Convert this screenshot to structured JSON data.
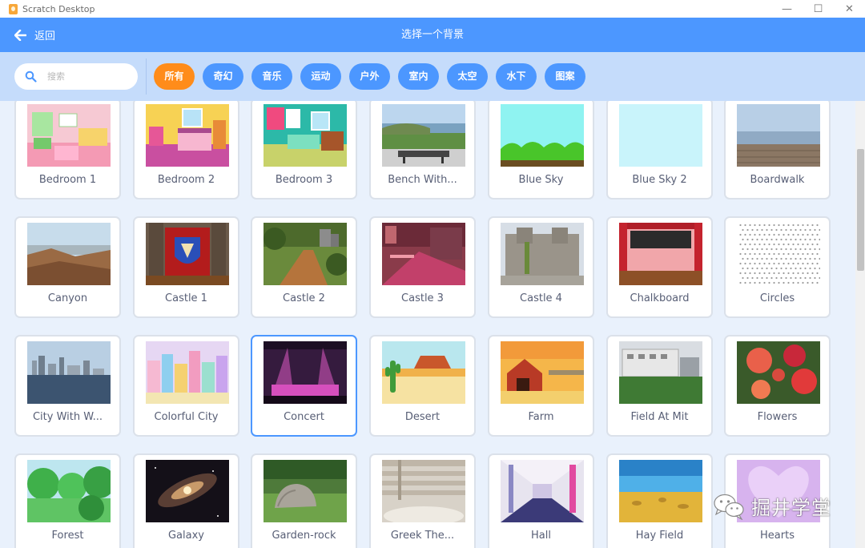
{
  "window": {
    "title": "Scratch Desktop",
    "minimize": "—",
    "maximize": "☐",
    "close": "✕"
  },
  "header": {
    "back_label": "返回",
    "title": "选择一个背景"
  },
  "search": {
    "placeholder": "搜索",
    "value": ""
  },
  "tags": [
    {
      "label": "所有",
      "active": true
    },
    {
      "label": "奇幻",
      "active": false
    },
    {
      "label": "音乐",
      "active": false
    },
    {
      "label": "运动",
      "active": false
    },
    {
      "label": "户外",
      "active": false
    },
    {
      "label": "室内",
      "active": false
    },
    {
      "label": "太空",
      "active": false
    },
    {
      "label": "水下",
      "active": false
    },
    {
      "label": "图案",
      "active": false
    }
  ],
  "backdrops": [
    {
      "name": "Bedroom 1",
      "icon": "bedroom-1-thumbnail"
    },
    {
      "name": "Bedroom 2",
      "icon": "bedroom-2-thumbnail"
    },
    {
      "name": "Bedroom 3",
      "icon": "bedroom-3-thumbnail"
    },
    {
      "name": "Bench With...",
      "icon": "bench-thumbnail"
    },
    {
      "name": "Blue Sky",
      "icon": "blue-sky-thumbnail"
    },
    {
      "name": "Blue Sky 2",
      "icon": "blue-sky-2-thumbnail"
    },
    {
      "name": "Boardwalk",
      "icon": "boardwalk-thumbnail"
    },
    {
      "name": "Canyon",
      "icon": "canyon-thumbnail"
    },
    {
      "name": "Castle 1",
      "icon": "castle-1-thumbnail"
    },
    {
      "name": "Castle 2",
      "icon": "castle-2-thumbnail"
    },
    {
      "name": "Castle 3",
      "icon": "castle-3-thumbnail"
    },
    {
      "name": "Castle 4",
      "icon": "castle-4-thumbnail"
    },
    {
      "name": "Chalkboard",
      "icon": "chalkboard-thumbnail"
    },
    {
      "name": "Circles",
      "icon": "circles-thumbnail"
    },
    {
      "name": "City With W...",
      "icon": "city-thumbnail"
    },
    {
      "name": "Colorful City",
      "icon": "colorful-city-thumbnail"
    },
    {
      "name": "Concert",
      "icon": "concert-thumbnail",
      "selected": true
    },
    {
      "name": "Desert",
      "icon": "desert-thumbnail"
    },
    {
      "name": "Farm",
      "icon": "farm-thumbnail"
    },
    {
      "name": "Field At Mit",
      "icon": "field-thumbnail"
    },
    {
      "name": "Flowers",
      "icon": "flowers-thumbnail"
    },
    {
      "name": "Forest",
      "icon": "forest-thumbnail"
    },
    {
      "name": "Galaxy",
      "icon": "galaxy-thumbnail"
    },
    {
      "name": "Garden-rock",
      "icon": "garden-rock-thumbnail"
    },
    {
      "name": "Greek The...",
      "icon": "greek-theater-thumbnail"
    },
    {
      "name": "Hall",
      "icon": "hall-thumbnail"
    },
    {
      "name": "Hay Field",
      "icon": "hay-field-thumbnail"
    },
    {
      "name": "Hearts",
      "icon": "hearts-thumbnail"
    }
  ],
  "watermark": {
    "text": "掘井学堂",
    "icon": "wechat-icon"
  },
  "colors": {
    "accent": "#4c97ff",
    "active_tag": "#ff8c1a",
    "filter_bg": "#c5dcfb",
    "page_bg": "#e9f1fc"
  }
}
